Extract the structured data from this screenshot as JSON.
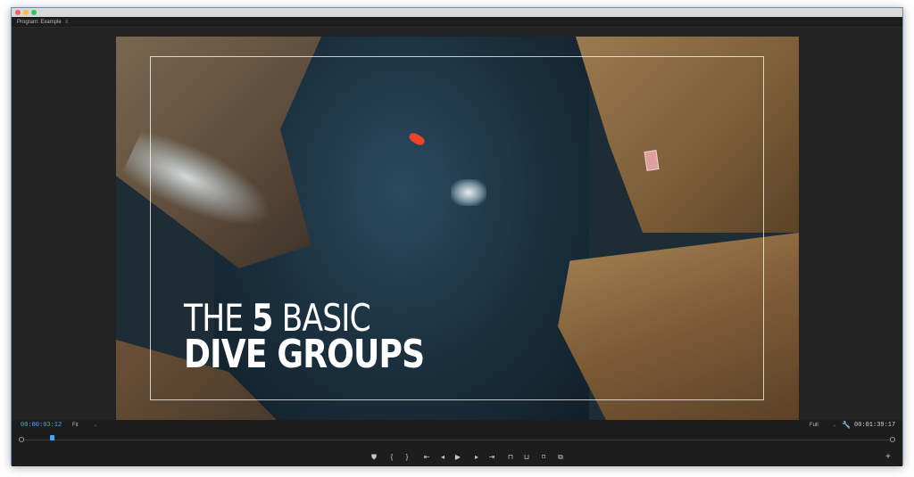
{
  "window": {
    "panel_title": "Program: Example",
    "panel_menu_icon": "hamburger-icon"
  },
  "video": {
    "title_line1_pre": "THE ",
    "title_line1_num": "5",
    "title_line1_post": " BASIC",
    "title_line2": "DIVE GROUPS"
  },
  "controls": {
    "current_timecode": "00:00:03:12",
    "zoom_value": "Fit",
    "resolution_value": "Full",
    "duration_timecode": "00:01:39:17",
    "playhead_fraction": 0.03,
    "transport": [
      {
        "name": "add-marker-button",
        "glyph": "⛊"
      },
      {
        "name": "mark-in-button",
        "glyph": "{"
      },
      {
        "name": "mark-out-button",
        "glyph": "}"
      },
      {
        "name": "go-to-in-button",
        "glyph": "⇤"
      },
      {
        "name": "step-back-button",
        "glyph": "◂"
      },
      {
        "name": "play-button",
        "glyph": "▶"
      },
      {
        "name": "step-forward-button",
        "glyph": "▸"
      },
      {
        "name": "go-to-out-button",
        "glyph": "⇥"
      },
      {
        "name": "lift-button",
        "glyph": "⊓"
      },
      {
        "name": "extract-button",
        "glyph": "⊔"
      },
      {
        "name": "export-frame-button",
        "glyph": "⌑"
      },
      {
        "name": "comparison-view-button",
        "glyph": "⧉"
      }
    ],
    "add_button_glyph": "+"
  },
  "colors": {
    "timecode_accent": "#4aa3ff",
    "panel_bg": "#1d1d1d",
    "window_border": "#6b8fb0"
  }
}
